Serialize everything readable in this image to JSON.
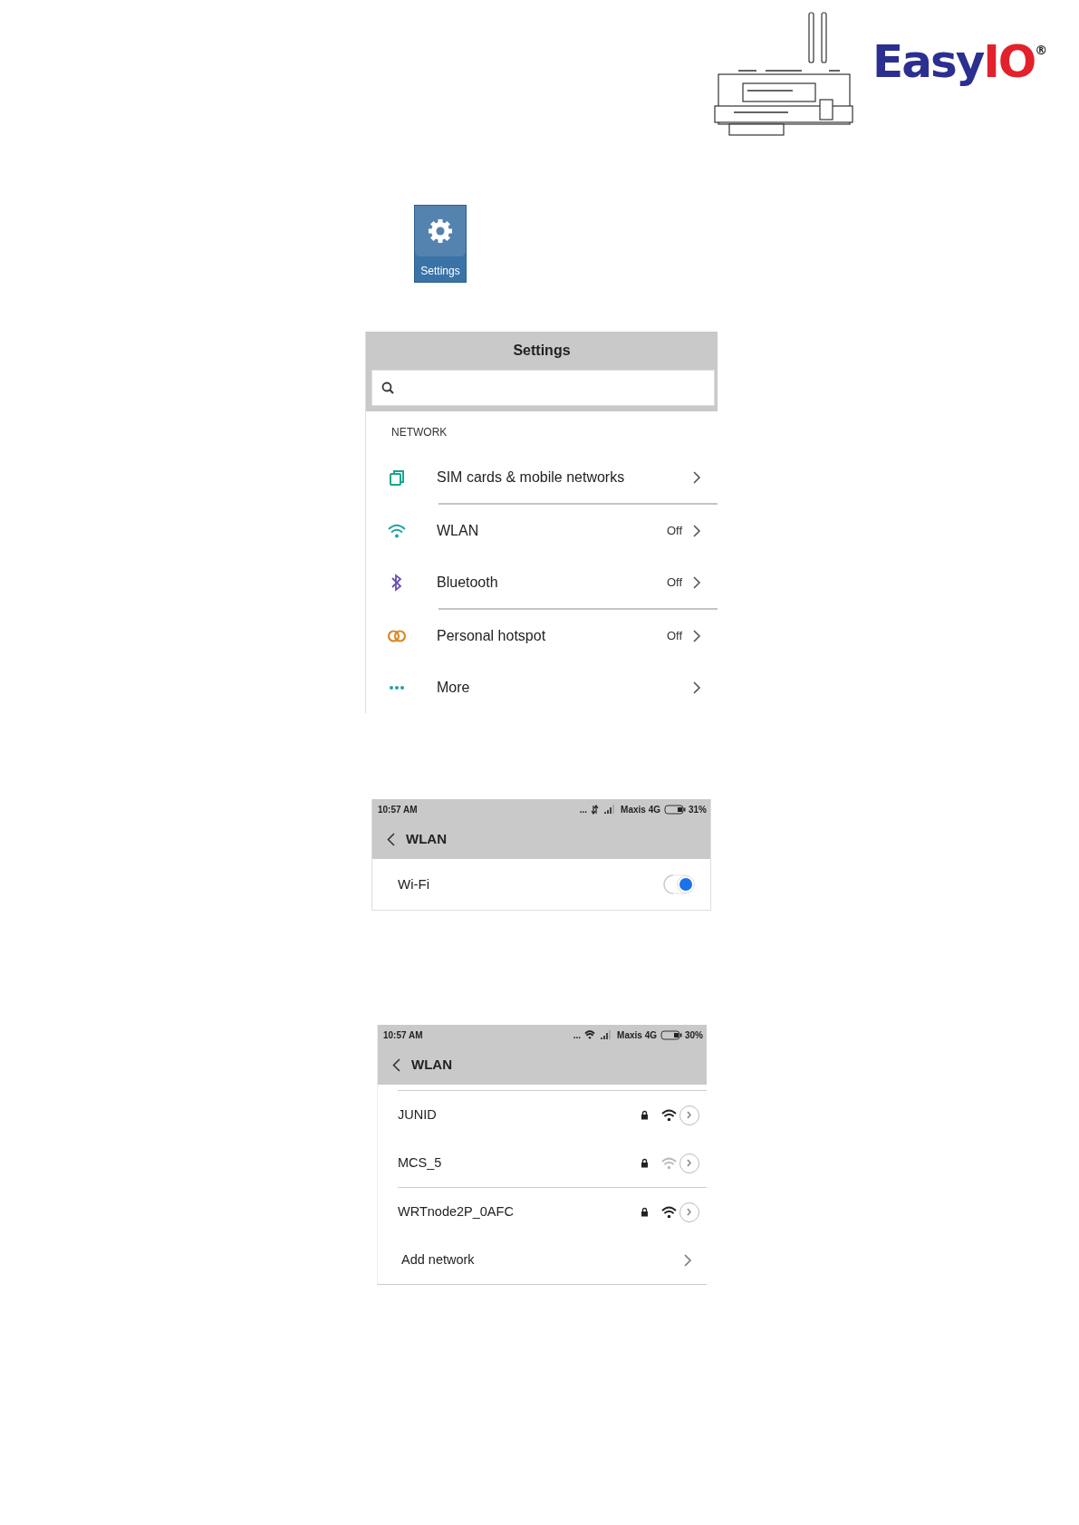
{
  "header": {
    "logo": {
      "part_1": "Easy",
      "part_2": "IO",
      "mark": "®"
    }
  },
  "app_icon": {
    "label": "Settings"
  },
  "settings_screen": {
    "title": "Settings",
    "section": "NETWORK",
    "items": [
      {
        "kind": "sim",
        "label": "SIM cards & mobile networks",
        "divider": true
      },
      {
        "kind": "wifi",
        "label": "WLAN",
        "value": "Off",
        "divider": false
      },
      {
        "kind": "bluetooth",
        "label": "Bluetooth",
        "value": "Off",
        "divider": true
      },
      {
        "kind": "hotspot",
        "label": "Personal hotspot",
        "value": "Off",
        "divider": false
      },
      {
        "kind": "more",
        "label": "More",
        "divider": false
      }
    ]
  },
  "wlan_screen_1": {
    "status_bar": {
      "time": "10:57 AM",
      "dots": "...",
      "carrier": "Maxis 4G",
      "battery": "31%",
      "kind": "arrows"
    },
    "title": "WLAN",
    "wifi": {
      "label": "Wi-Fi",
      "on": true
    }
  },
  "wlan_screen_2": {
    "status_bar": {
      "time": "10:57 AM",
      "dots": "...",
      "carrier": "Maxis 4G",
      "battery": "30%",
      "kind": "wifi"
    },
    "title": "WLAN",
    "networks": [
      {
        "name": "JUNID",
        "strong_signal": true,
        "divider_above": true
      },
      {
        "name": "MCS_5",
        "strong_signal": false,
        "divider_above": false
      },
      {
        "name": "WRTnode2P_0AFC",
        "strong_signal": true,
        "divider_above": true
      }
    ],
    "add_network": "Add network"
  }
}
